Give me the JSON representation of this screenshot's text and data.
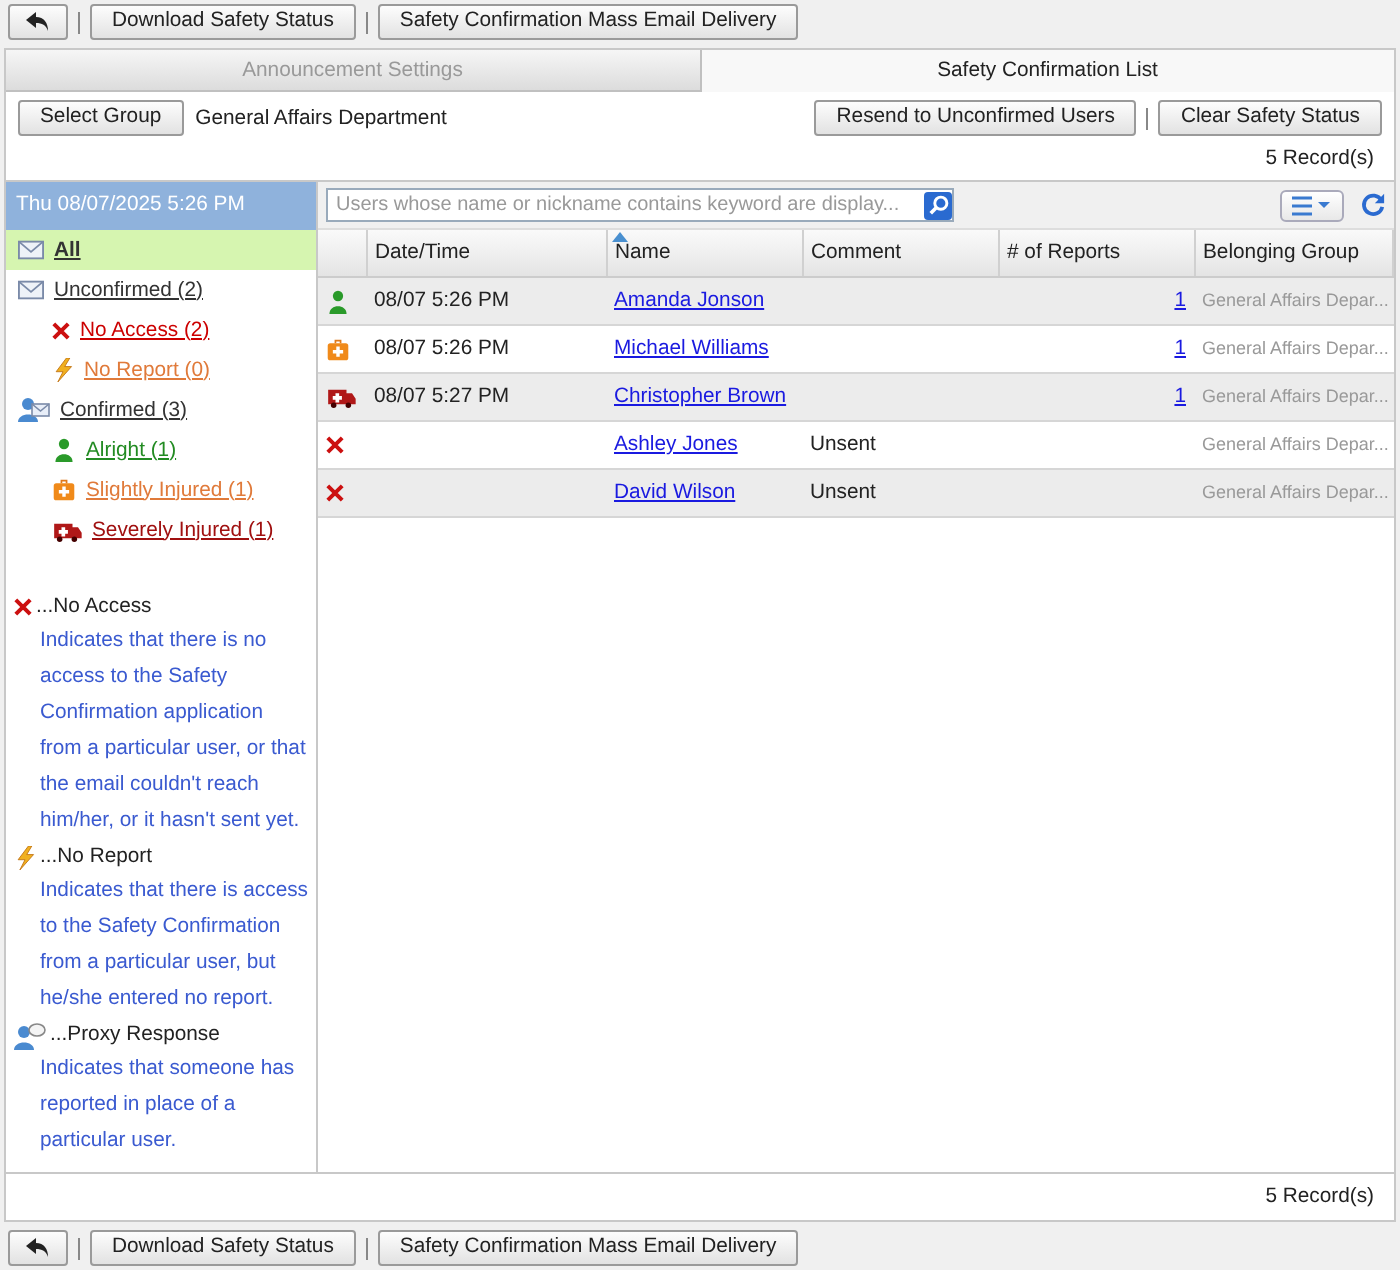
{
  "top_toolbar": {
    "buttons": [
      "Download Safety Status",
      "Safety Confirmation Mass Email Delivery"
    ]
  },
  "tabs": [
    {
      "label": "Announcement Settings",
      "selected": false
    },
    {
      "label": "Safety Confirmation List",
      "selected": true
    }
  ],
  "group_bar": {
    "select_button": "Select Group",
    "group": "General Affairs Department",
    "actions": [
      "Resend to Unconfirmed Users",
      "Clear Safety Status"
    ]
  },
  "record_count_top": "5 Record(s)",
  "sidebar": {
    "date": "Thu 08/07/2025 5:26 PM",
    "items": [
      {
        "label": "All",
        "kind": "mail",
        "selected": true,
        "color": "#333333"
      },
      {
        "label": "Unconfirmed (2)",
        "kind": "mail",
        "selected": false,
        "color": "#333333",
        "children": [
          {
            "label": "No Access (2)",
            "kind": "cross",
            "selected": false,
            "color": "#cc0000"
          },
          {
            "label": "No Report (0)",
            "kind": "bolt",
            "selected": false,
            "color": "#e07a3a"
          }
        ]
      },
      {
        "label": "Confirmed (3)",
        "kind": "people",
        "selected": false,
        "color": "#333333",
        "children": [
          {
            "label": "Alright (1)",
            "kind": "person",
            "selected": false,
            "color": "#228b22"
          },
          {
            "label": "Slightly Injured (1)",
            "kind": "medkit",
            "selected": false,
            "color": "#e07a3a"
          },
          {
            "label": "Severely Injured (1)",
            "kind": "ambulance",
            "selected": false,
            "color": "#a01010"
          }
        ]
      }
    ],
    "legend": [
      {
        "kind": "cross",
        "title": "...No Access",
        "text": "Indicates that there is no access to the Safety Confirmation application from a particular user, or that the email couldn't reach him/her, or it hasn't sent yet."
      },
      {
        "kind": "bolt",
        "title": "...No Report",
        "text": "Indicates that there is access to the Safety Confirmation from a particular user, but he/she entered no report."
      },
      {
        "kind": "proxy",
        "title": "...Proxy Response",
        "text": "Indicates that someone has reported in place of a particular user."
      }
    ]
  },
  "search": {
    "placeholder": "Users whose name or nickname contains keyword are display..."
  },
  "table": {
    "columns": [
      {
        "label": "Date/Time",
        "sorted": false
      },
      {
        "label": "Name",
        "sorted": true
      },
      {
        "label": "Comment",
        "sorted": false
      },
      {
        "label": "# of Reports",
        "sorted": false
      },
      {
        "label": "Belonging Group",
        "sorted": false
      }
    ],
    "rows": [
      {
        "kind": "person",
        "datetime": "08/07 5:26 PM",
        "name": "Amanda Jonson",
        "reports": "1",
        "group": "General Affairs Depar..."
      },
      {
        "kind": "medkit",
        "datetime": "08/07 5:26 PM",
        "name": "Michael Williams",
        "reports": "1",
        "group": "General Affairs Depar..."
      },
      {
        "kind": "ambulance",
        "datetime": "08/07 5:27 PM",
        "name": "Christopher Brown",
        "reports": "1",
        "group": "General Affairs Depar..."
      },
      {
        "kind": "cross",
        "name": "Ashley Jones",
        "comment": "Unsent",
        "group": "General Affairs Depar..."
      },
      {
        "kind": "cross",
        "name": "David Wilson",
        "comment": "Unsent",
        "group": "General Affairs Depar..."
      }
    ]
  },
  "record_count_bottom": "5 Record(s)",
  "bottom_toolbar": {
    "buttons": [
      "Download Safety Status",
      "Safety Confirmation Mass Email Delivery"
    ]
  }
}
